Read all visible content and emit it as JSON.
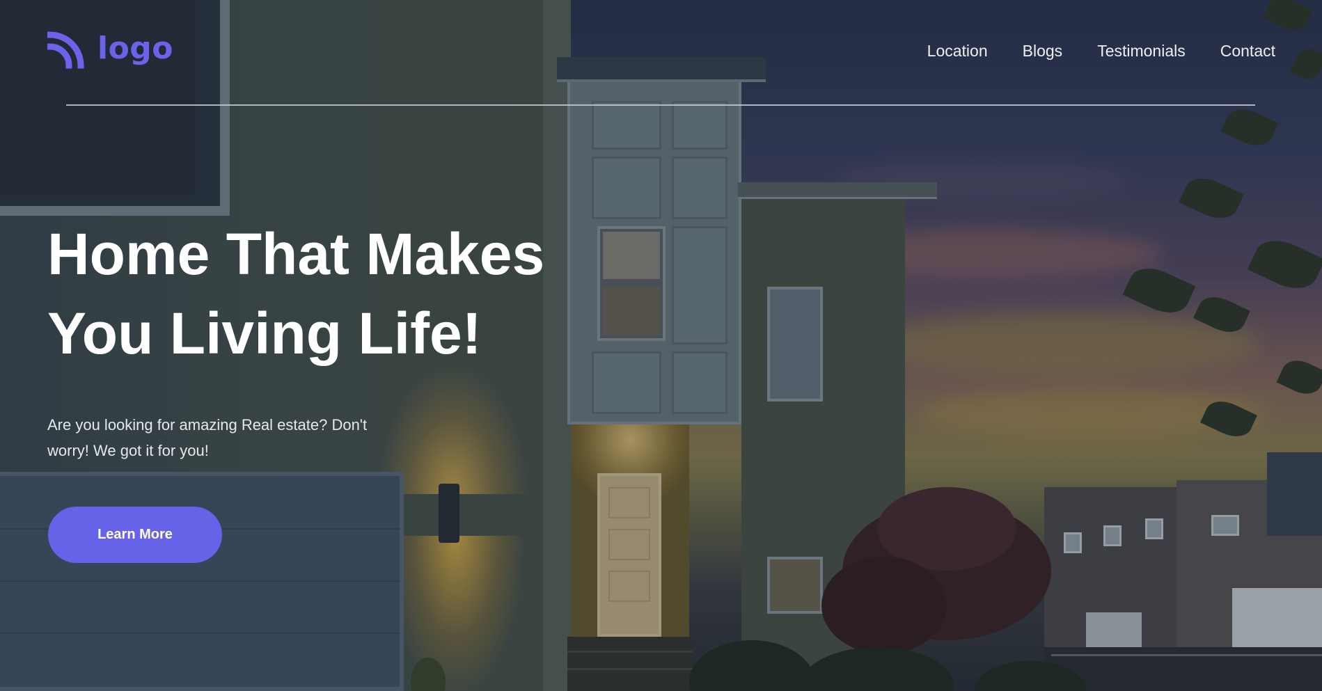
{
  "brand": {
    "logo_text": "logo",
    "logo_icon": "rss-arcs-icon",
    "accent_color": "#6763e8"
  },
  "nav": {
    "items": [
      {
        "label": "Location"
      },
      {
        "label": "Blogs"
      },
      {
        "label": "Testimonials"
      },
      {
        "label": "Contact"
      }
    ]
  },
  "hero": {
    "headline_line1": "Home That Makes",
    "headline_line2": "You Living Life!",
    "subtext": "Are you looking for amazing Real estate? Don't worry! We got it for you!",
    "cta_label": "Learn More",
    "background_image": "house-at-dusk"
  }
}
